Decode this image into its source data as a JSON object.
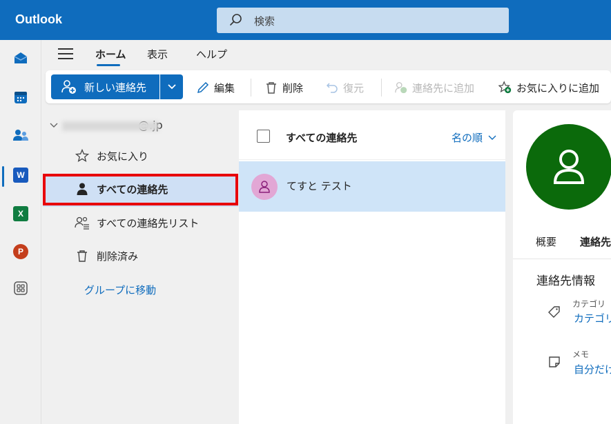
{
  "header": {
    "app_title": "Outlook",
    "search_placeholder": "検索"
  },
  "rail": {
    "apps": [
      {
        "name": "mail",
        "label": ""
      },
      {
        "name": "calendar",
        "label": ""
      },
      {
        "name": "people",
        "label": ""
      },
      {
        "name": "word",
        "label": "W"
      },
      {
        "name": "excel",
        "label": "X"
      },
      {
        "name": "powerpoint",
        "label": "P"
      },
      {
        "name": "apps",
        "label": ""
      }
    ],
    "colors": {
      "word": "#185abd",
      "excel": "#107c41",
      "powerpoint": "#c43e1c",
      "accent": "#0f6cbd"
    }
  },
  "tabs": {
    "items": [
      "ホーム",
      "表示",
      "ヘルプ"
    ],
    "active": "ホーム"
  },
  "ribbon": {
    "new_contact": "新しい連絡先",
    "edit": "編集",
    "delete": "削除",
    "restore": "復元",
    "add_to_contacts": "連絡先に追加",
    "add_to_favorites": "お気に入りに追加"
  },
  "folders": {
    "account": "@.jp",
    "items": [
      {
        "label": "お気に入り",
        "icon": "star-icon"
      },
      {
        "label": "すべての連絡先",
        "icon": "person-icon",
        "selected": true
      },
      {
        "label": "すべての連絡先リスト",
        "icon": "people-list-icon"
      },
      {
        "label": "削除済み",
        "icon": "trash-icon"
      }
    ],
    "go_to_groups": "グループに移動"
  },
  "list": {
    "title": "すべての連絡先",
    "sort_label": "名の順",
    "contacts": [
      {
        "name": "てすと テスト"
      }
    ]
  },
  "detail": {
    "tabs": [
      "概要",
      "連絡先"
    ],
    "section_title": "連絡先情報",
    "fields": [
      {
        "label": "カテゴリ",
        "value": "カテゴリを"
      },
      {
        "label": "メモ",
        "value": "自分だけ"
      }
    ],
    "avatar_color": "#0b6a0b"
  }
}
